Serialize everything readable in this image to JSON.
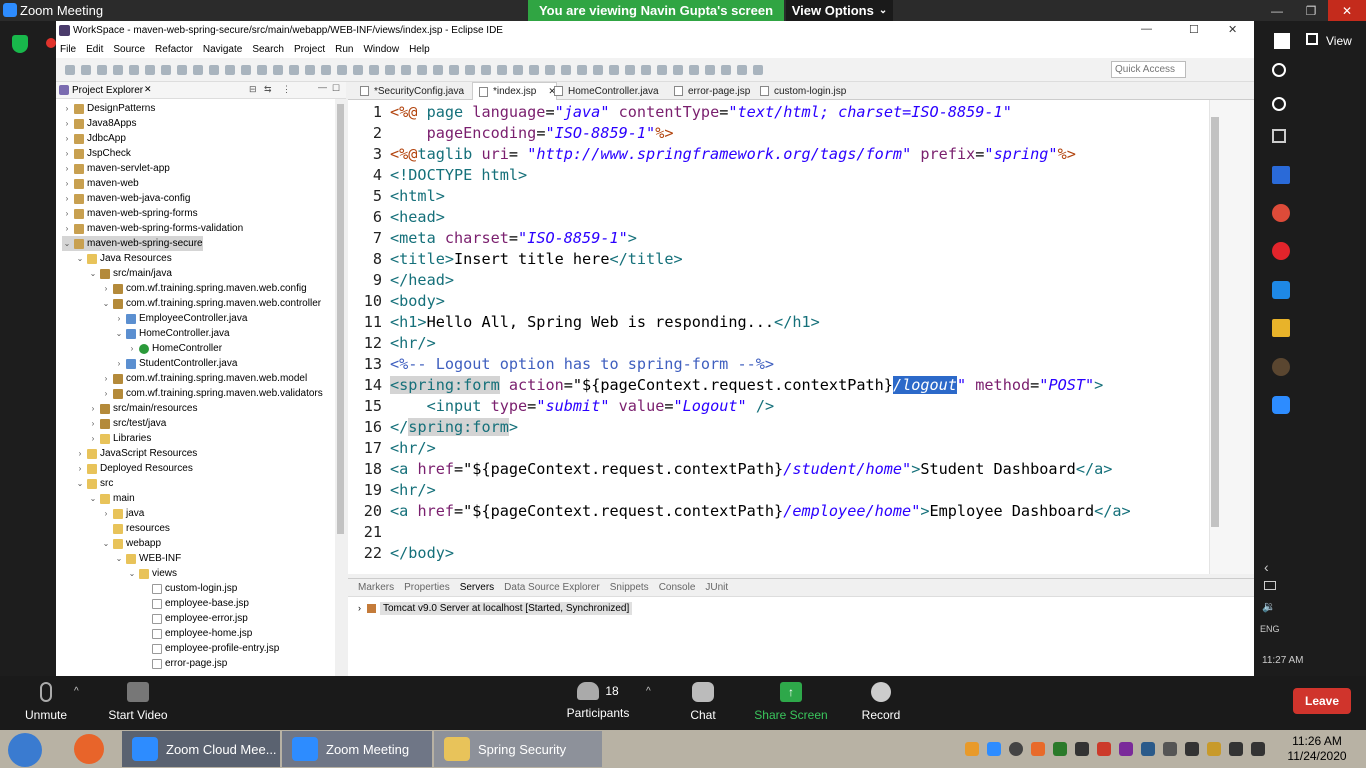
{
  "zoom": {
    "window_title": "Zoom Meeting",
    "viewing_banner": "You are viewing Navin Gupta's screen",
    "view_options": "View Options",
    "bottom": {
      "unmute": "Unmute",
      "start_video": "Start Video",
      "participants_count": "18",
      "participants": "Participants",
      "chat": "Chat",
      "share_screen": "Share Screen",
      "record": "Record",
      "leave": "Leave"
    }
  },
  "eclipse": {
    "title": "WorkSpace - maven-web-spring-secure/src/main/webapp/WEB-INF/views/index.jsp - Eclipse IDE",
    "menu": [
      "File",
      "Edit",
      "Source",
      "Refactor",
      "Navigate",
      "Search",
      "Project",
      "Run",
      "Window",
      "Help"
    ],
    "quick_access_placeholder": "Quick Access",
    "project_explorer_title": "Project Explorer",
    "tree": [
      {
        "label": "DesignPatterns",
        "indent": 0,
        "arrow": "›",
        "icon": "proj"
      },
      {
        "label": "Java8Apps",
        "indent": 0,
        "arrow": "›",
        "icon": "proj"
      },
      {
        "label": "JdbcApp",
        "indent": 0,
        "arrow": "›",
        "icon": "proj"
      },
      {
        "label": "JspCheck",
        "indent": 0,
        "arrow": "›",
        "icon": "proj"
      },
      {
        "label": "maven-servlet-app",
        "indent": 0,
        "arrow": "›",
        "icon": "proj"
      },
      {
        "label": "maven-web",
        "indent": 0,
        "arrow": "›",
        "icon": "proj"
      },
      {
        "label": "maven-web-java-config",
        "indent": 0,
        "arrow": "›",
        "icon": "proj"
      },
      {
        "label": "maven-web-spring-forms",
        "indent": 0,
        "arrow": "›",
        "icon": "proj"
      },
      {
        "label": "maven-web-spring-forms-validation",
        "indent": 0,
        "arrow": "›",
        "icon": "proj"
      },
      {
        "label": "maven-web-spring-secure",
        "indent": 0,
        "arrow": "⌄",
        "icon": "proj",
        "selected": true
      },
      {
        "label": "Java Resources",
        "indent": 1,
        "arrow": "⌄",
        "icon": "folder"
      },
      {
        "label": "src/main/java",
        "indent": 2,
        "arrow": "⌄",
        "icon": "pkg"
      },
      {
        "label": "com.wf.training.spring.maven.web.config",
        "indent": 3,
        "arrow": "›",
        "icon": "pkg"
      },
      {
        "label": "com.wf.training.spring.maven.web.controller",
        "indent": 3,
        "arrow": "⌄",
        "icon": "pkg"
      },
      {
        "label": "EmployeeController.java",
        "indent": 4,
        "arrow": "›",
        "icon": "java"
      },
      {
        "label": "HomeController.java",
        "indent": 4,
        "arrow": "⌄",
        "icon": "java"
      },
      {
        "label": "HomeController",
        "indent": 5,
        "arrow": "›",
        "icon": "class"
      },
      {
        "label": "StudentController.java",
        "indent": 4,
        "arrow": "›",
        "icon": "java"
      },
      {
        "label": "com.wf.training.spring.maven.web.model",
        "indent": 3,
        "arrow": "›",
        "icon": "pkg"
      },
      {
        "label": "com.wf.training.spring.maven.web.validators",
        "indent": 3,
        "arrow": "›",
        "icon": "pkg"
      },
      {
        "label": "src/main/resources",
        "indent": 2,
        "arrow": "›",
        "icon": "pkg"
      },
      {
        "label": "src/test/java",
        "indent": 2,
        "arrow": "›",
        "icon": "pkg"
      },
      {
        "label": "Libraries",
        "indent": 2,
        "arrow": "›",
        "icon": "folder"
      },
      {
        "label": "JavaScript Resources",
        "indent": 1,
        "arrow": "›",
        "icon": "folder"
      },
      {
        "label": "Deployed Resources",
        "indent": 1,
        "arrow": "›",
        "icon": "folder"
      },
      {
        "label": "src",
        "indent": 1,
        "arrow": "⌄",
        "icon": "folder"
      },
      {
        "label": "main",
        "indent": 2,
        "arrow": "⌄",
        "icon": "folder"
      },
      {
        "label": "java",
        "indent": 3,
        "arrow": "›",
        "icon": "folder"
      },
      {
        "label": "resources",
        "indent": 3,
        "arrow": "",
        "icon": "folder"
      },
      {
        "label": "webapp",
        "indent": 3,
        "arrow": "⌄",
        "icon": "folder"
      },
      {
        "label": "WEB-INF",
        "indent": 4,
        "arrow": "⌄",
        "icon": "folder"
      },
      {
        "label": "views",
        "indent": 5,
        "arrow": "⌄",
        "icon": "folder"
      },
      {
        "label": "custom-login.jsp",
        "indent": 6,
        "arrow": "",
        "icon": "file"
      },
      {
        "label": "employee-base.jsp",
        "indent": 6,
        "arrow": "",
        "icon": "file"
      },
      {
        "label": "employee-error.jsp",
        "indent": 6,
        "arrow": "",
        "icon": "file"
      },
      {
        "label": "employee-home.jsp",
        "indent": 6,
        "arrow": "",
        "icon": "file"
      },
      {
        "label": "employee-profile-entry.jsp",
        "indent": 6,
        "arrow": "",
        "icon": "file"
      },
      {
        "label": "error-page.jsp",
        "indent": 6,
        "arrow": "",
        "icon": "file"
      }
    ],
    "tabs": [
      {
        "label": "*SecurityConfig.java",
        "active": false
      },
      {
        "label": "*index.jsp",
        "active": true
      },
      {
        "label": "HomeController.java",
        "active": false
      },
      {
        "label": "error-page.jsp",
        "active": false
      },
      {
        "label": "custom-login.jsp",
        "active": false
      }
    ],
    "code_lines": [
      {
        "n": "1",
        "segs": [
          [
            "dir",
            "<%@ "
          ],
          [
            "tag",
            "page "
          ],
          [
            "attr",
            "language"
          ],
          [
            "",
            "="
          ],
          [
            "str",
            "\"java\""
          ],
          [
            "",
            " "
          ],
          [
            "attr",
            "contentType"
          ],
          [
            "",
            "="
          ],
          [
            "str",
            "\"text/html; charset=ISO-8859-1\""
          ]
        ]
      },
      {
        "n": "2",
        "segs": [
          [
            "",
            " "
          ],
          [
            "attr",
            "   pageEncoding"
          ],
          [
            "",
            "="
          ],
          [
            "str",
            "\"ISO-8859-1\""
          ],
          [
            "dir",
            "%>"
          ]
        ]
      },
      {
        "n": "3",
        "segs": [
          [
            "dir",
            "<%@"
          ],
          [
            "tag",
            "taglib "
          ],
          [
            "attr",
            "uri"
          ],
          [
            "",
            "= "
          ],
          [
            "str",
            "\"http://www.springframework.org/tags/form\""
          ],
          [
            "",
            " "
          ],
          [
            "attr",
            "prefix"
          ],
          [
            "",
            "="
          ],
          [
            "str",
            "\"spring\""
          ],
          [
            "dir",
            "%>"
          ]
        ]
      },
      {
        "n": "4",
        "segs": [
          [
            "tag",
            "<!DOCTYPE html>"
          ]
        ]
      },
      {
        "n": "5",
        "segs": [
          [
            "tag",
            "<html>"
          ]
        ]
      },
      {
        "n": "6",
        "segs": [
          [
            "tag",
            "<head>"
          ]
        ]
      },
      {
        "n": "7",
        "segs": [
          [
            "tag",
            "<meta "
          ],
          [
            "attr",
            "charset"
          ],
          [
            "",
            "="
          ],
          [
            "str",
            "\"ISO-8859-1\""
          ],
          [
            "tag",
            ">"
          ]
        ]
      },
      {
        "n": "8",
        "segs": [
          [
            "tag",
            "<title>"
          ],
          [
            "",
            "Insert title here"
          ],
          [
            "tag",
            "</title>"
          ]
        ]
      },
      {
        "n": "9",
        "segs": [
          [
            "tag",
            "</head>"
          ]
        ]
      },
      {
        "n": "10",
        "segs": [
          [
            "tag",
            "<body>"
          ]
        ]
      },
      {
        "n": "11",
        "segs": [
          [
            "tag",
            "<h1>"
          ],
          [
            "",
            "Hello All, Spring Web is responding..."
          ],
          [
            "tag",
            "</h1>"
          ]
        ]
      },
      {
        "n": "12",
        "segs": [
          [
            "tag",
            "<hr/>"
          ]
        ]
      },
      {
        "n": "13",
        "segs": [
          [
            "cmt",
            "<%-- Logout option has to spring-form --%>"
          ]
        ]
      },
      {
        "n": "14",
        "segs": [
          [
            "tag hl",
            "<spring:form"
          ],
          [
            "",
            " "
          ],
          [
            "attr",
            "action"
          ],
          [
            "",
            "=\"${pageContext.request.contextPath}"
          ],
          [
            "str sel",
            "/logout"
          ],
          [
            "str",
            "\""
          ],
          [
            "",
            " "
          ],
          [
            "attr",
            "method"
          ],
          [
            "",
            "="
          ],
          [
            "str",
            "\"POST\""
          ],
          [
            "tag",
            ">"
          ]
        ]
      },
      {
        "n": "15",
        "segs": [
          [
            "tag",
            "    <input "
          ],
          [
            "attr",
            "type"
          ],
          [
            "",
            "="
          ],
          [
            "str",
            "\"submit\""
          ],
          [
            "",
            " "
          ],
          [
            "attr",
            "value"
          ],
          [
            "",
            "="
          ],
          [
            "str",
            "\"Logout\""
          ],
          [
            "tag",
            " />"
          ]
        ]
      },
      {
        "n": "16",
        "segs": [
          [
            "tag",
            "</"
          ],
          [
            "tag hl",
            "spring:form"
          ],
          [
            "tag",
            ">"
          ]
        ]
      },
      {
        "n": "17",
        "segs": [
          [
            "tag",
            "<hr/>"
          ]
        ]
      },
      {
        "n": "18",
        "segs": [
          [
            "tag",
            "<a "
          ],
          [
            "attr",
            "href"
          ],
          [
            "",
            "=\"${pageContext.request.contextPath}"
          ],
          [
            "str",
            "/student/home\""
          ],
          [
            "tag",
            ">"
          ],
          [
            "",
            "Student Dashboard"
          ],
          [
            "tag",
            "</a>"
          ]
        ]
      },
      {
        "n": "19",
        "segs": [
          [
            "tag",
            "<hr/>"
          ]
        ]
      },
      {
        "n": "20",
        "segs": [
          [
            "tag",
            "<a "
          ],
          [
            "attr",
            "href"
          ],
          [
            "",
            "=\"${pageContext.request.contextPath}"
          ],
          [
            "str",
            "/employee/home\""
          ],
          [
            "tag",
            ">"
          ],
          [
            "",
            "Employee Dashboard"
          ],
          [
            "tag",
            "</a>"
          ]
        ]
      },
      {
        "n": "21",
        "segs": [
          [
            "",
            ""
          ]
        ]
      },
      {
        "n": "22",
        "segs": [
          [
            "tag",
            "</body>"
          ]
        ]
      }
    ],
    "bottom_tabs": [
      "Markers",
      "Properties",
      "Servers",
      "Data Source Explorer",
      "Snippets",
      "Console",
      "JUnit"
    ],
    "server_entry": "Tomcat v9.0 Server at localhost  [Started, Synchronized]"
  },
  "right_strip": {
    "view": "View",
    "lang": "ENG",
    "time": "11:27 AM"
  },
  "taskbar": {
    "tasks": [
      "Zoom Cloud Mee...",
      "Zoom Meeting",
      "Spring Security"
    ],
    "time": "11:26 AM",
    "date": "11/24/2020"
  },
  "colors": {
    "banner": "#30a543",
    "leave": "#d0342c",
    "selection": "#2c69c9"
  }
}
